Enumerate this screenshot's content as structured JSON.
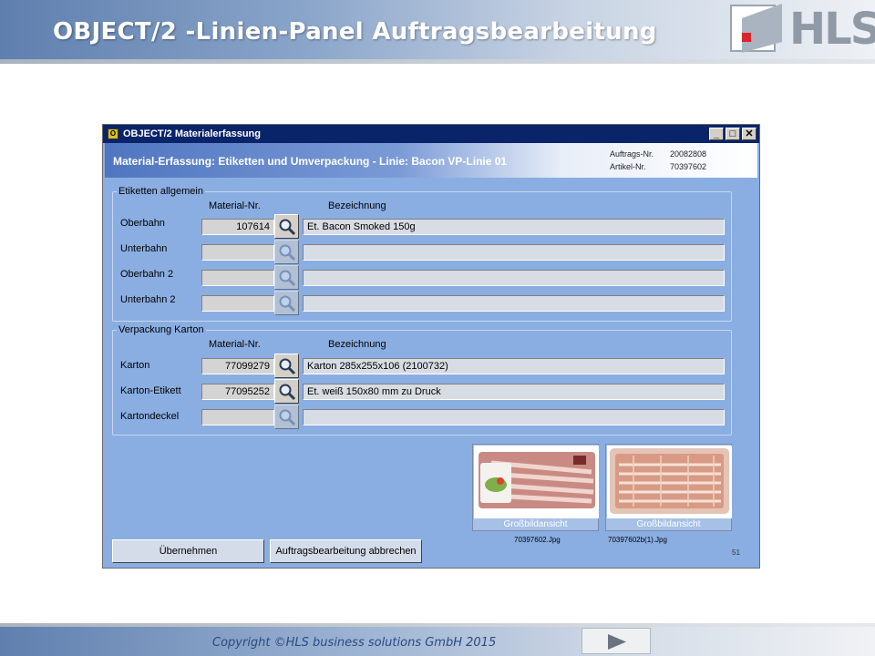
{
  "slide": {
    "title": "OBJECT/2 -Linien-Panel Auftragsbearbeitung",
    "logo_text": "HLS",
    "copyright": "Copyright ©HLS business solutions GmbH 2015"
  },
  "window": {
    "title": "OBJECT/2 Materialerfassung",
    "controls": {
      "minimize": "_",
      "maximize": "□",
      "close": "✕"
    }
  },
  "banner": {
    "text": "Material-Erfassung: Etiketten und Umverpackung -  Linie: Bacon VP-Linie 01",
    "auftrag_label": "Auftrags-Nr.",
    "auftrag_value": "20082808",
    "artikel_label": "Artikel-Nr.",
    "artikel_value": "70397602"
  },
  "etiketten": {
    "title": "Etiketten allgemein",
    "col_material": "Material-Nr.",
    "col_bezeichnung": "Bezeichnung",
    "rows": [
      {
        "label": "Oberbahn",
        "material": "107614",
        "description": "Et. Bacon Smoked 150g"
      },
      {
        "label": "Unterbahn",
        "material": "",
        "description": ""
      },
      {
        "label": "Oberbahn 2",
        "material": "",
        "description": ""
      },
      {
        "label": "Unterbahn 2",
        "material": "",
        "description": ""
      }
    ]
  },
  "verpackung": {
    "title": "Verpackung Karton",
    "col_material": "Material-Nr.",
    "col_bezeichnung": "Bezeichnung",
    "rows": [
      {
        "label": "Karton",
        "material": "77099279",
        "description": "Karton 285x255x106 (2100732)"
      },
      {
        "label": "Karton-Etikett",
        "material": "77095252",
        "description": "Et. weiß 150x80 mm zu Druck"
      },
      {
        "label": "Kartondeckel",
        "material": "",
        "description": ""
      }
    ]
  },
  "images": [
    {
      "caption": "Großbildansicht",
      "filename": "70397602.Jpg"
    },
    {
      "caption": "Großbildansicht",
      "filename": "70397602b(1).Jpg"
    }
  ],
  "page_number": "51",
  "buttons": {
    "accept": "Übernehmen",
    "cancel": "Auftragsbearbeitung abbrechen"
  },
  "colors": {
    "window_bg": "#8aaee2",
    "titlebar": "#0a246a",
    "slide_title": "#ffffff",
    "copyright": "#2a4a86"
  }
}
